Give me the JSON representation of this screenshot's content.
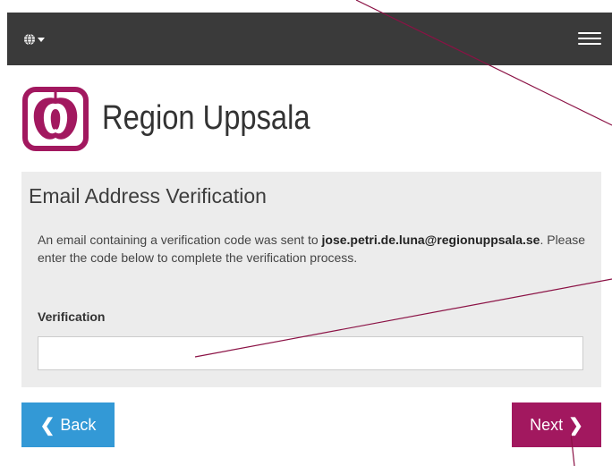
{
  "header": {
    "language_icon": "globe-icon",
    "menu_icon": "hamburger-menu-icon",
    "background_color": "#3a3a3a"
  },
  "brand": {
    "name": "Region Uppsala",
    "logo_icon": "region-uppsala-apple-logo",
    "color": "#a2185f"
  },
  "verification": {
    "title": "Email Address Verification",
    "message_before": "An email containing a verification code was sent to ",
    "email": "jose.petri.de.luna@regionuppsala.se",
    "message_after": ". Please enter the code below to complete the verification process.",
    "field_label": "Verification",
    "field_value": "",
    "field_placeholder": ""
  },
  "buttons": {
    "back_label": "Back",
    "back_color": "#3399d6",
    "next_label": "Next",
    "next_color": "#a2185f"
  }
}
